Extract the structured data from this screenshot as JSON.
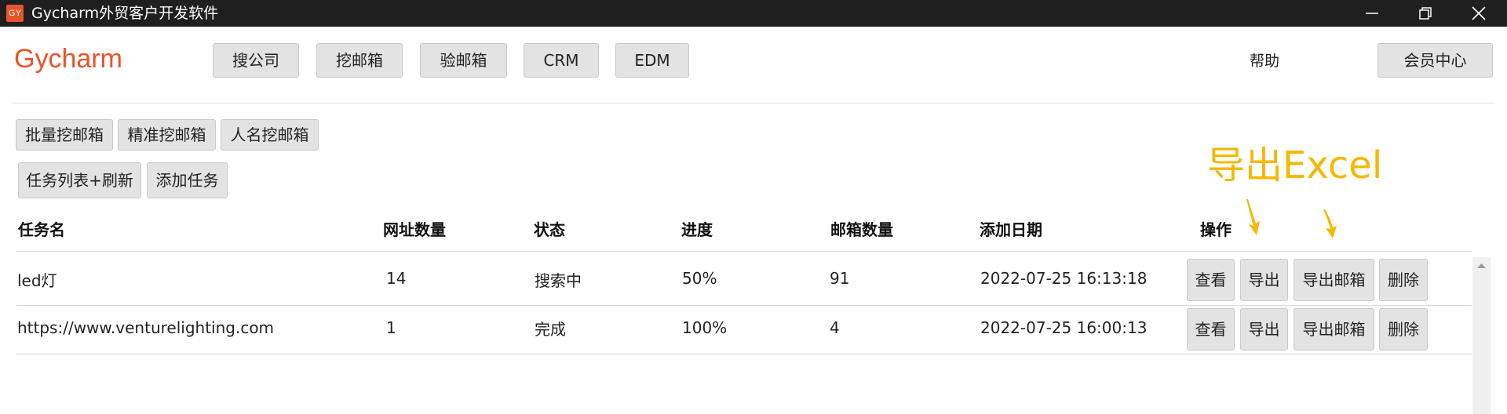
{
  "window": {
    "icon_text": "GY",
    "title": "Gycharm外贸客户开发软件"
  },
  "header": {
    "brand": "Gycharm",
    "nav": [
      "搜公司",
      "挖邮箱",
      "验邮箱",
      "CRM",
      "EDM"
    ],
    "help": "帮助",
    "member": "会员中心"
  },
  "subnav": {
    "modes": [
      "批量挖邮箱",
      "精准挖邮箱",
      "人名挖邮箱"
    ],
    "task_list_refresh": "任务列表+刷新",
    "add_task": "添加任务"
  },
  "annotation": {
    "text": "导出Excel",
    "color": "#f5b800"
  },
  "table": {
    "columns": [
      "任务名",
      "网址数量",
      "状态",
      "进度",
      "邮箱数量",
      "添加日期",
      "操作"
    ],
    "rows": [
      {
        "name": "led灯",
        "url_count": "14",
        "status": "搜索中",
        "progress": "50%",
        "email_count": "91",
        "date": "2022-07-25 16:13:18"
      },
      {
        "name": "https://www.venturelighting.com",
        "url_count": "1",
        "status": "完成",
        "progress": "100%",
        "email_count": "4",
        "date": "2022-07-25 16:00:13"
      }
    ],
    "actions": [
      "查看",
      "导出",
      "导出邮箱",
      "删除"
    ]
  },
  "colors": {
    "brand": "#e8542a",
    "titlebar": "#1f1f1f",
    "button_bg": "#e3e3e3"
  }
}
